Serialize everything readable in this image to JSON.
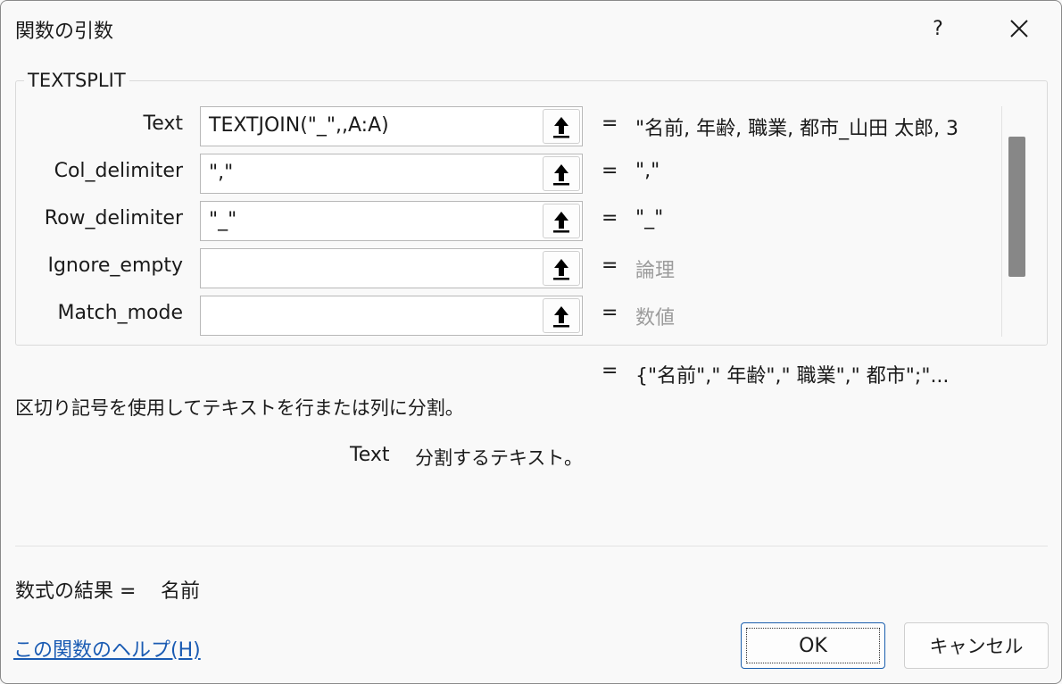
{
  "window": {
    "title": "関数の引数",
    "help_label": "?"
  },
  "group": {
    "function_name": "TEXTSPLIT"
  },
  "args": [
    {
      "label": "Text",
      "value": "TEXTJOIN(\"_\",,A:A)",
      "equals": "=",
      "result": "\"名前, 年齢, 職業, 都市_山田 太郎, 3"
    },
    {
      "label": "Col_delimiter",
      "value": "\",\"",
      "equals": "=",
      "result": "\",\""
    },
    {
      "label": "Row_delimiter",
      "value": "\"_\"",
      "equals": "=",
      "result": "\"_\""
    },
    {
      "label": "Ignore_empty",
      "value": "",
      "equals": "=",
      "result": "論理"
    },
    {
      "label": "Match_mode",
      "value": "",
      "equals": "=",
      "result": "数値"
    }
  ],
  "total": {
    "equals": "=",
    "result": "{\"名前\",\" 年齢\",\" 職業\",\" 都市\";\"..."
  },
  "description": "区切り記号を使用してテキストを行または列に分割。",
  "arg_help": {
    "name": "Text",
    "text": "分割するテキスト。"
  },
  "formula_result": {
    "label": "数式の結果 =",
    "value": "名前"
  },
  "help_link": "この関数のヘルプ(H)",
  "buttons": {
    "ok": "OK",
    "cancel": "キャンセル"
  },
  "icons": {
    "close": "close-icon",
    "collapse": "arrow-up-icon"
  }
}
